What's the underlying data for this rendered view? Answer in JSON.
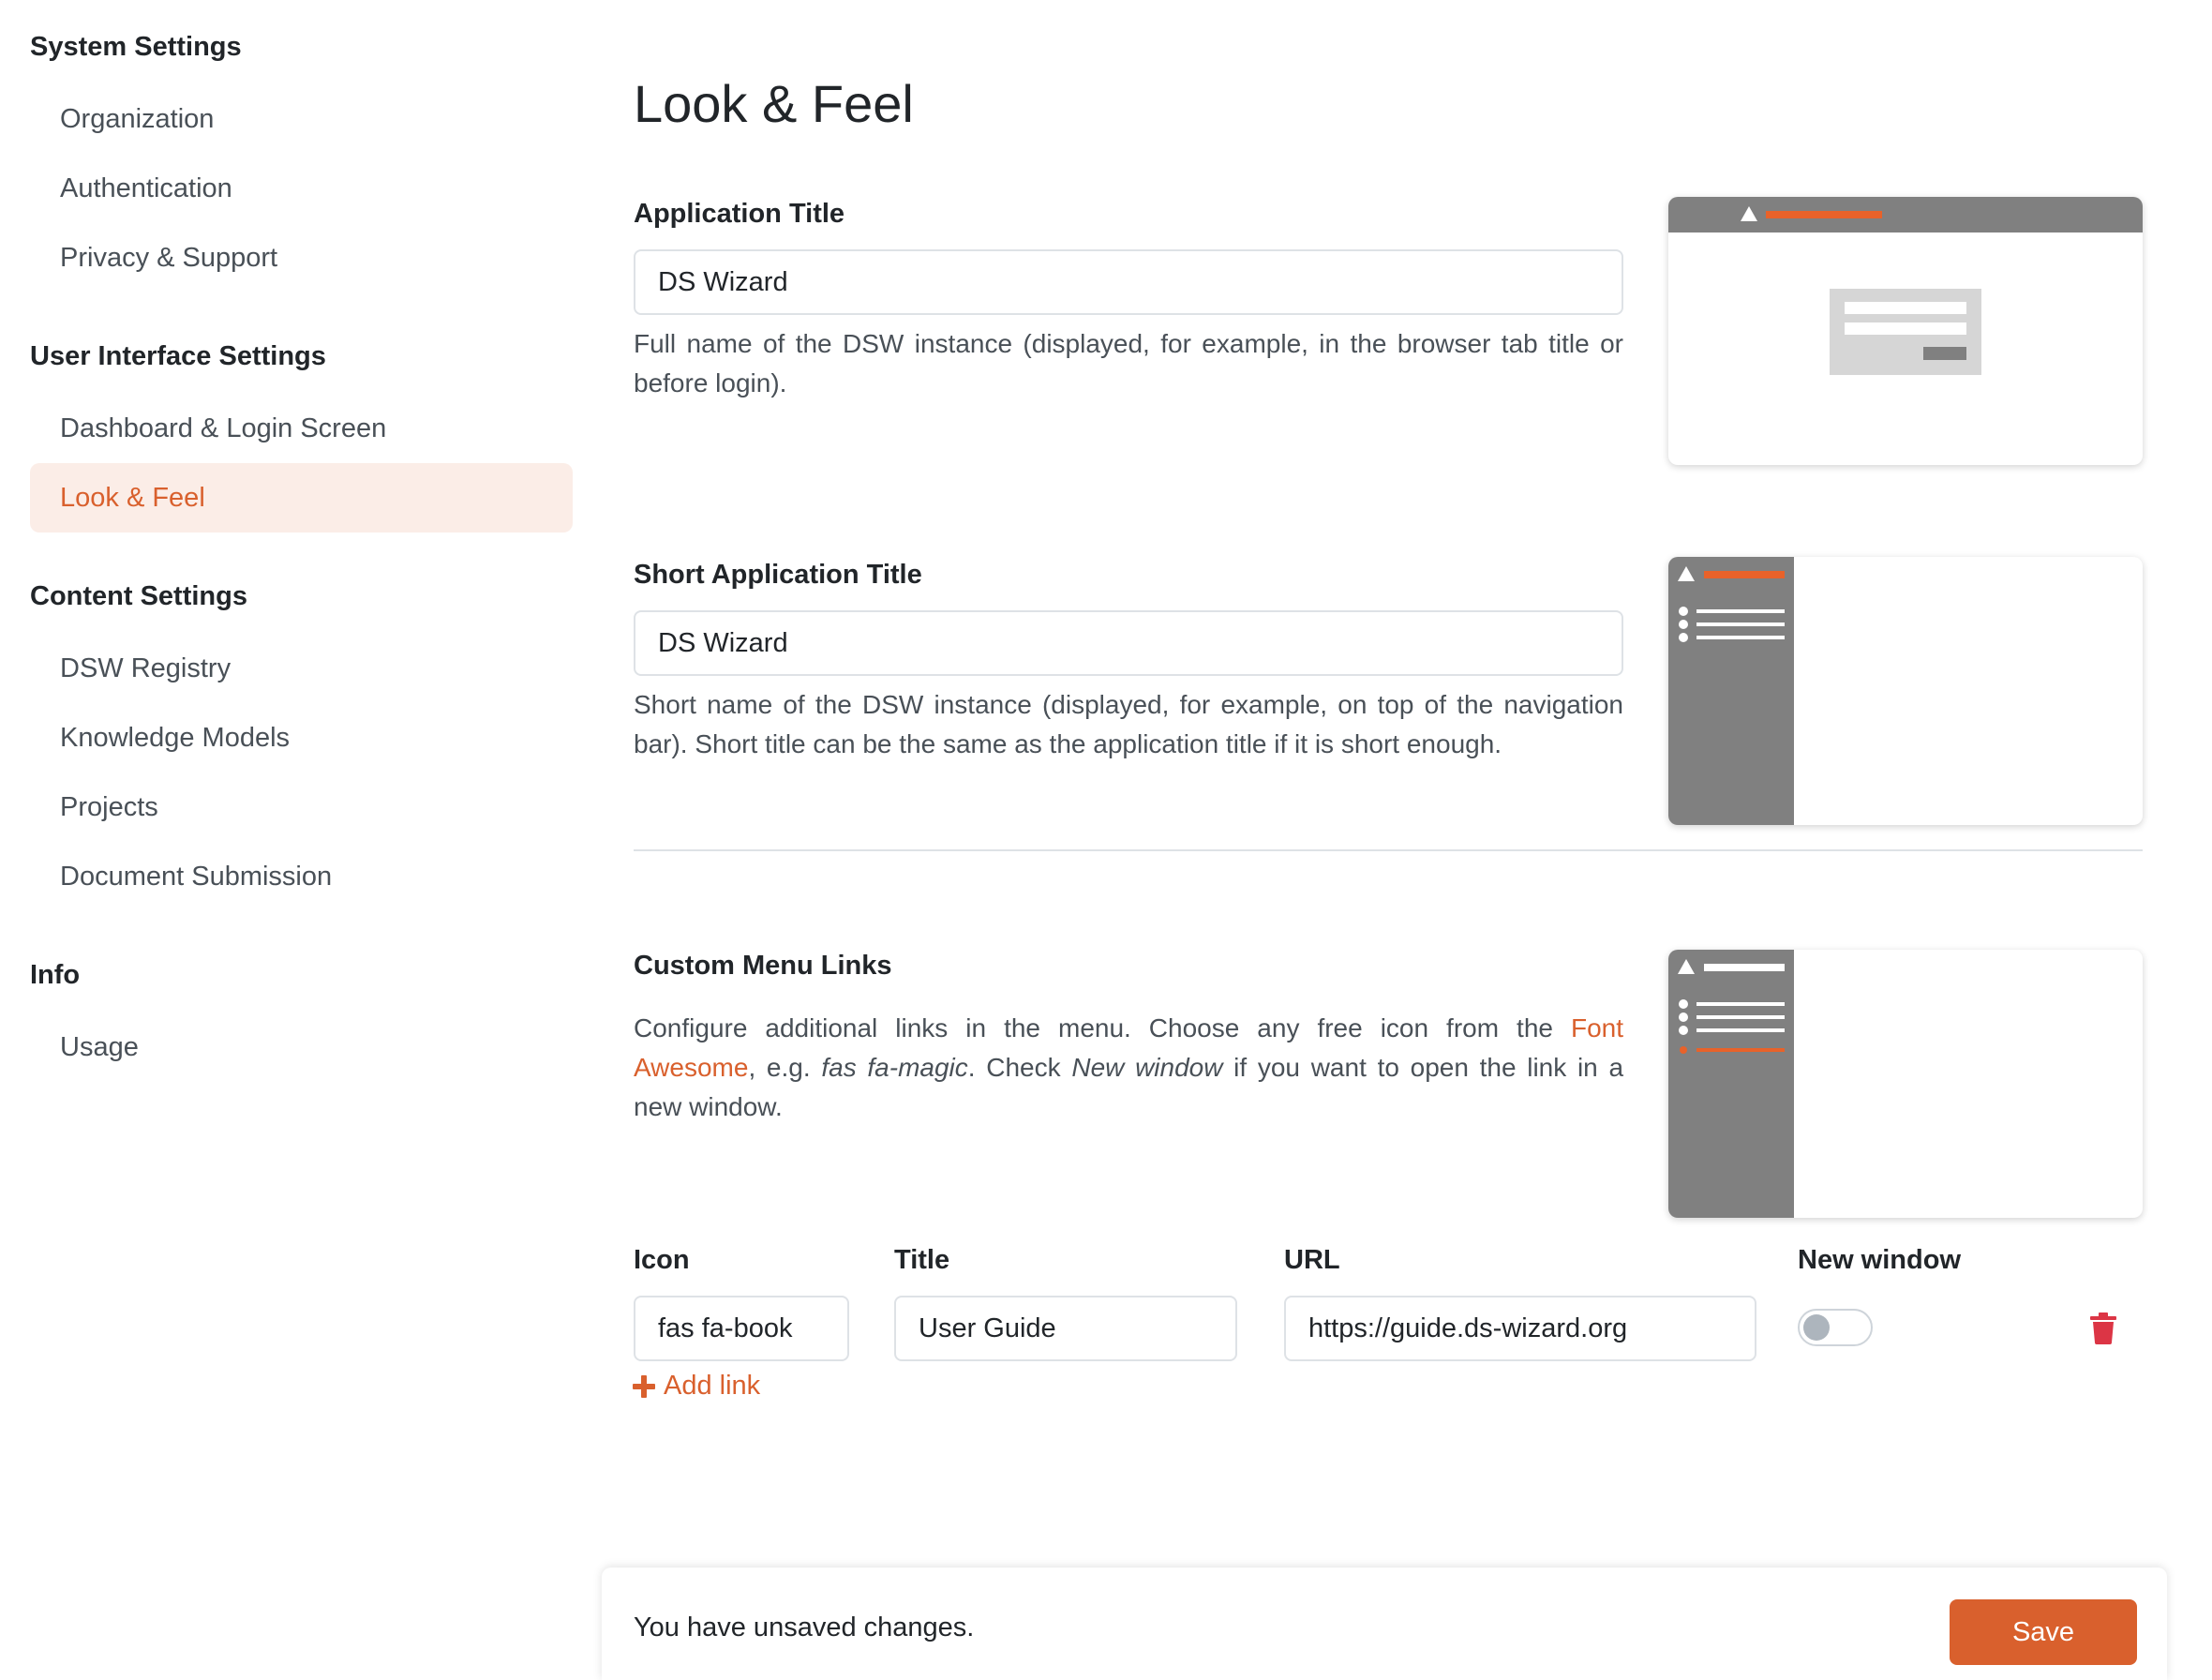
{
  "sidebar": {
    "sections": [
      {
        "heading": "System Settings",
        "items": [
          "Organization",
          "Authentication",
          "Privacy & Support"
        ]
      },
      {
        "heading": "User Interface Settings",
        "items": [
          "Dashboard & Login Screen",
          "Look & Feel"
        ]
      },
      {
        "heading": "Content Settings",
        "items": [
          "DSW Registry",
          "Knowledge Models",
          "Projects",
          "Document Submission"
        ]
      },
      {
        "heading": "Info",
        "items": [
          "Usage"
        ]
      }
    ],
    "active_item": "Look & Feel"
  },
  "main": {
    "title": "Look & Feel",
    "app_title": {
      "label": "Application Title",
      "value": "DS Wizard",
      "help": "Full name of the DSW instance (displayed, for example, in the browser tab title or before login)."
    },
    "short_title": {
      "label": "Short Application Title",
      "value": "DS Wizard",
      "help": "Short name of the DSW instance (displayed, for example, on top of the navigation bar). Short title can be the same as the application title if it is short enough."
    },
    "custom_links": {
      "label": "Custom Menu Links",
      "help_part1": "Configure additional links in the menu. Choose any free icon from the ",
      "help_link": "Font Awesome",
      "help_part2": ", e.g. ",
      "help_example": "fas fa-magic",
      "help_part3": ". Check ",
      "help_option": "New window",
      "help_part4": " if you want to open the link in a new window.",
      "columns": {
        "icon": "Icon",
        "title": "Title",
        "url": "URL",
        "new_window": "New window"
      },
      "rows": [
        {
          "icon": "fas fa-book",
          "title": "User Guide",
          "url": "https://guide.ds-wizard.org",
          "new_window": false
        }
      ],
      "add_link": "Add link"
    }
  },
  "footer": {
    "message": "You have unsaved changes.",
    "save_label": "Save"
  },
  "colors": {
    "accent": "#d9602d",
    "active_bg": "#fbede7",
    "preview_gray": "#808080",
    "danger": "#dc3545"
  }
}
